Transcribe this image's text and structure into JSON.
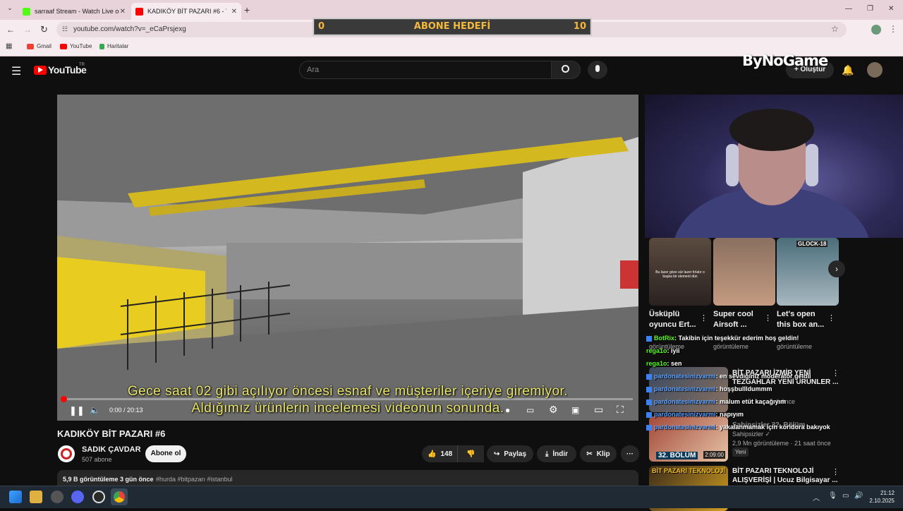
{
  "browser": {
    "tabs": [
      {
        "title": "sarraaf Stream - Watch Live on",
        "favicon_color": "#53fc18",
        "active": false
      },
      {
        "title": "KADIKÖY BİT PAZARI #6 - Yo",
        "favicon_color": "#ff0000",
        "active": true
      }
    ],
    "new_tab": "+",
    "url": "youtube.com/watch?v=_eCaPrsjexg",
    "bookmarks": [
      "Gmail",
      "YouTube",
      "Haritalar"
    ],
    "window_controls": [
      "—",
      "❐",
      "✕"
    ]
  },
  "overlay": {
    "goal_left": "0",
    "goal_label": "ABONE HEDEFİ",
    "goal_right": "10",
    "brand": "ByNoGame"
  },
  "youtube": {
    "logo": "YouTube",
    "region": "TR",
    "search_placeholder": "Ara",
    "create_label": "+ Oluştur",
    "video": {
      "subtitle_line1": "Gece saat 02 gibi açılıyor öncesi esnaf ve müşteriler içeriye giremiyor.",
      "subtitle_line2": "Aldığımız ürünlerin incelemesi videonun sonunda.",
      "time": "0:00 / 20:13",
      "progress": 0
    },
    "title": "KADIKÖY BİT PAZARI #6",
    "channel": {
      "name": "SADIK ÇAVDAR",
      "subs": "507 abone",
      "subscribe": "Abone ol"
    },
    "actions": {
      "likes": "148",
      "share": "Paylaş",
      "download": "İndir",
      "clip": "Klip",
      "more": "···"
    },
    "description": {
      "views": "5,9 B görüntüleme",
      "date": "3 gün önce",
      "tags": "#hurda #bitpazarı #istanbul"
    },
    "shorts": [
      {
        "title1": "Üsküplü",
        "title2": "oyuncu Ert...",
        "views": "görüntüleme",
        "thumb_text": "Bu lazer göze sür lazer fırlatır o başka bir element dün"
      },
      {
        "title1": "Super cool",
        "title2": "Airsoft ...",
        "views": "görüntüleme"
      },
      {
        "title1": "Let's open",
        "title2": "this box an...",
        "views": "görüntüleme",
        "thumb_text": "GLOCK-18"
      }
    ],
    "recommended": [
      {
        "title1": "BİT PAZARI İZMİR YENİ",
        "title2": "TEZGAHLAR YENİ ÜRÜNLER ...",
        "meta": "ü önce"
      },
      {
        "title1": "Sahipsizler 32. Bölüm",
        "meta1": "Sahipsizler ✓",
        "meta": "2,9 Mn görüntüleme · 21 saat önce",
        "badge": "Yeni",
        "duration": "2:09:00",
        "thumb_text": "32. BÖLÜM"
      },
      {
        "title1": "BİT PAZARI TEKNOLOJİ",
        "title2": "ALIŞVERİŞİ | Ucuz Bilgisayar ...",
        "thumb_text": "BİT PAZARI TEKNOLOJİ"
      }
    ]
  },
  "chat": [
    {
      "user": "BotRix",
      "msg": ": Takibin için teşekkür ederim hoş geldin!",
      "color": "#53fc18"
    },
    {
      "user": "rega1o",
      "msg": ": iyii",
      "color": "#53fc18"
    },
    {
      "user": "rega1o",
      "msg": ": sen",
      "color": "#53fc18"
    },
    {
      "user": "pardonatesinizvarmi",
      "msg": ": en sevdiğiniz moderatör geldii",
      "color": "#5aa0ff"
    },
    {
      "user": "pardonatesinizvarmi",
      "msg": ": hoşşbullldummm",
      "color": "#5aa0ff"
    },
    {
      "user": "pardonatesinizvarmi",
      "msg": ": malum etüt kaçağıyım",
      "color": "#5aa0ff"
    },
    {
      "user": "pardonatesinizvarmi",
      "msg": ": napıyım",
      "color": "#5aa0ff"
    },
    {
      "user": "pardonatesinizvarmi",
      "msg": ": yakalanmamak için koridora bakıyok",
      "color": "#5aa0ff"
    }
  ],
  "taskbar": {
    "time": "21:12",
    "date": "2.10.2025"
  }
}
